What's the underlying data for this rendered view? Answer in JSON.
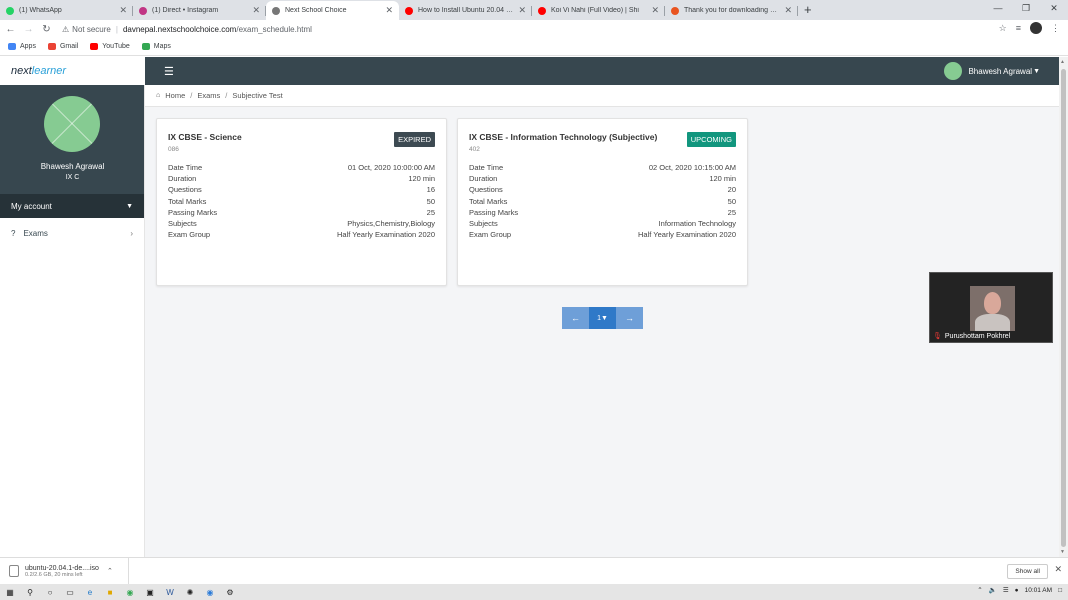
{
  "browser": {
    "tabs": [
      {
        "title": "(1) WhatsApp",
        "fav_color": "#25d366",
        "active": false
      },
      {
        "title": "(1) Direct • Instagram",
        "fav_color": "#c13584",
        "active": false
      },
      {
        "title": "Next School Choice",
        "fav_color": "#777777",
        "active": true
      },
      {
        "title": "How to Install Ubuntu 20.04 LTS",
        "fav_color": "#ff0000",
        "active": false
      },
      {
        "title": "Koi Vi Nahi (Full Video) | Shi",
        "fav_color": "#ff0000",
        "active": false
      },
      {
        "title": "Thank you for downloading Ubu",
        "fav_color": "#e95420",
        "active": false
      }
    ],
    "new_tab": "+",
    "address": {
      "security": "Not secure",
      "host": "davnepal.nextschoolchoice.com",
      "path": "/exam_schedule.html"
    },
    "bookmarks": [
      {
        "label": "Apps",
        "color": "#4285f4"
      },
      {
        "label": "Gmail",
        "color": "#ea4335"
      },
      {
        "label": "YouTube",
        "color": "#ff0000"
      },
      {
        "label": "Maps",
        "color": "#34a853"
      }
    ]
  },
  "app": {
    "logo_part1": "next",
    "logo_part2": "learner",
    "user_name": "Bhawesh Agrawal",
    "user_class": "IX C",
    "my_account": "My account",
    "sidebar_items": [
      {
        "label": "Exams"
      }
    ],
    "header_user": "Bhawesh Agrawal"
  },
  "breadcrumb": [
    "Home",
    "Exams",
    "Subjective Test"
  ],
  "field_labels": [
    "Date Time",
    "Duration",
    "Questions",
    "Total Marks",
    "Passing Marks",
    "Subjects",
    "Exam Group"
  ],
  "exams": [
    {
      "title": "IX CBSE - Science",
      "code": "086",
      "status": "EXPIRED",
      "status_color": "#3d4a52",
      "values": [
        "01 Oct, 2020 10:00:00 AM",
        "120 min",
        "16",
        "50",
        "25",
        "Physics,Chemistry,Biology",
        "Half Yearly Examination 2020"
      ]
    },
    {
      "title": "IX CBSE - Information Technology (Subjective)",
      "code": "402",
      "status": "UPCOMING",
      "status_color": "#12967e",
      "values": [
        "02 Oct, 2020 10:15:00 AM",
        "120 min",
        "20",
        "50",
        "25",
        "Information Technology",
        "Half Yearly Examination 2020"
      ]
    }
  ],
  "pagination": {
    "current": "1"
  },
  "video": {
    "participant": "Purushottam Pokhrel"
  },
  "downloads": {
    "file": "ubuntu-20.04.1-de....iso",
    "status": "0.2/2.6 GB, 20 mins left",
    "show_all": "Show all"
  },
  "taskbar": {
    "time": "10:01 AM"
  }
}
